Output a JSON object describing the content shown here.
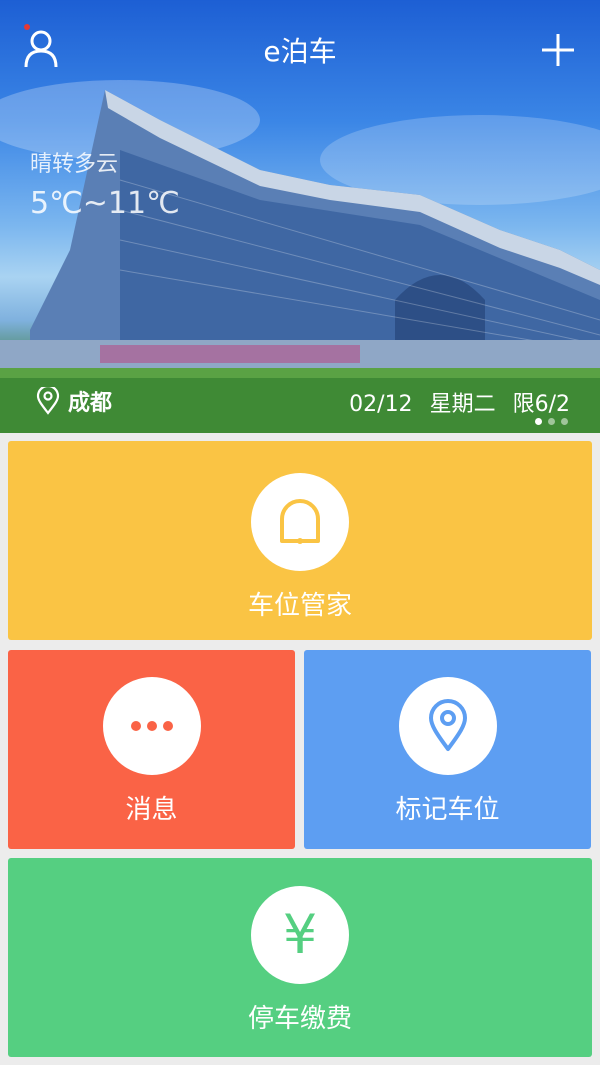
{
  "app": {
    "title": "e泊车"
  },
  "header": {
    "user_icon": "user-icon",
    "add_icon": "plus-icon",
    "notification_dot_color": "#e53935"
  },
  "weather": {
    "description": "晴转多云",
    "temperature": "5℃~11℃"
  },
  "location": {
    "city": "成都",
    "icon": "location-pin-icon"
  },
  "date_info": {
    "date": "02/12",
    "weekday": "星期二",
    "restriction": "限6/2"
  },
  "carousel": {
    "page_count": 3,
    "active_index": 0
  },
  "tiles": {
    "manager": {
      "label": "车位管家",
      "icon": "bell-icon",
      "color": "#fac444"
    },
    "messages": {
      "label": "消息",
      "icon": "more-dots-icon",
      "color": "#fa6346"
    },
    "mark_spot": {
      "label": "标记车位",
      "icon": "map-pin-icon",
      "color": "#5d9ef2"
    },
    "payment": {
      "label": "停车缴费",
      "icon": "yen-icon",
      "icon_glyph": "¥",
      "color": "#55cf81"
    }
  }
}
